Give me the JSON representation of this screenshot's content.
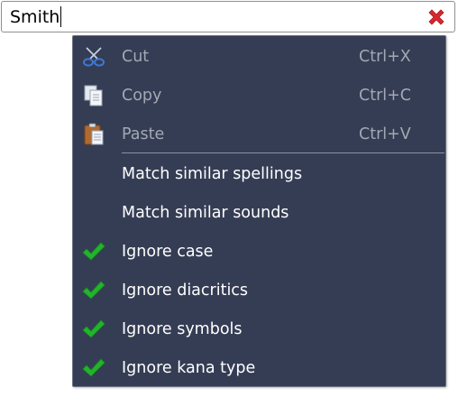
{
  "search": {
    "value": "Smith"
  },
  "clear_icon": "close-icon",
  "menu": {
    "edit_items": [
      {
        "label": "Cut",
        "shortcut": "Ctrl+X",
        "icon": "scissors-icon",
        "enabled": false
      },
      {
        "label": "Copy",
        "shortcut": "Ctrl+C",
        "icon": "copy-icon",
        "enabled": false
      },
      {
        "label": "Paste",
        "shortcut": "Ctrl+V",
        "icon": "paste-icon",
        "enabled": false
      }
    ],
    "options": [
      {
        "label": "Match similar spellings",
        "checked": false
      },
      {
        "label": "Match similar sounds",
        "checked": false
      },
      {
        "label": "Ignore case",
        "checked": true
      },
      {
        "label": "Ignore diacritics",
        "checked": true
      },
      {
        "label": "Ignore symbols",
        "checked": true
      },
      {
        "label": "Ignore kana type",
        "checked": true
      }
    ]
  },
  "colors": {
    "menu_background": "#353d54",
    "check_green": "#22b42c",
    "clear_red": "#d8272d",
    "disabled_text": "#a3a8b4"
  }
}
